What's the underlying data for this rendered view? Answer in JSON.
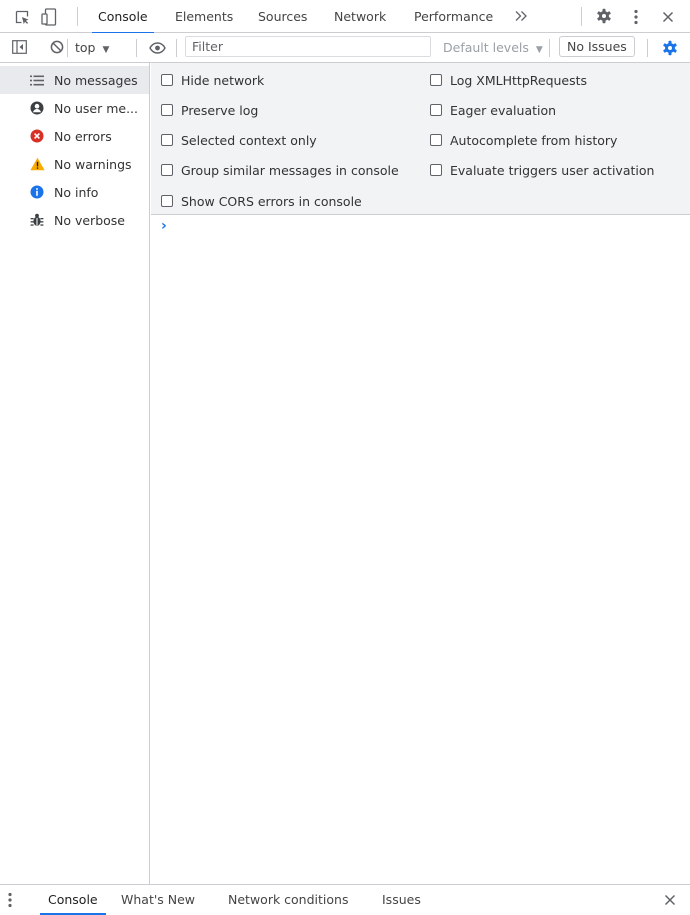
{
  "top_tabs": {
    "tabs": [
      "Console",
      "Elements",
      "Sources",
      "Network",
      "Performance"
    ],
    "more_icon": "double-chevron-right-icon",
    "active": "Console"
  },
  "toolbar": {
    "context": "top",
    "filter_placeholder": "Filter",
    "levels": "Default levels",
    "issues": "No Issues"
  },
  "sidebar": {
    "items": [
      {
        "label": "No messages",
        "icon": "list-icon"
      },
      {
        "label": "No user me...",
        "icon": "user-icon"
      },
      {
        "label": "No errors",
        "icon": "error-icon"
      },
      {
        "label": "No warnings",
        "icon": "warning-icon"
      },
      {
        "label": "No info",
        "icon": "info-icon"
      },
      {
        "label": "No verbose",
        "icon": "bug-icon"
      }
    ]
  },
  "settings": {
    "left": [
      "Hide network",
      "Preserve log",
      "Selected context only",
      "Group similar messages in console",
      "Show CORS errors in console"
    ],
    "right": [
      "Log XMLHttpRequests",
      "Eager evaluation",
      "Autocomplete from history",
      "Evaluate triggers user activation"
    ]
  },
  "console": {
    "prompt": "›"
  },
  "drawer": {
    "tabs": [
      "Console",
      "What's New",
      "Network conditions",
      "Issues"
    ],
    "active": "Console"
  },
  "colors": {
    "accent": "#1a73e8",
    "error": "#d93025",
    "warning": "#f9ab00",
    "info": "#1a73e8",
    "panel_bg": "#f1f3f4",
    "border": "#cbcdd1"
  }
}
